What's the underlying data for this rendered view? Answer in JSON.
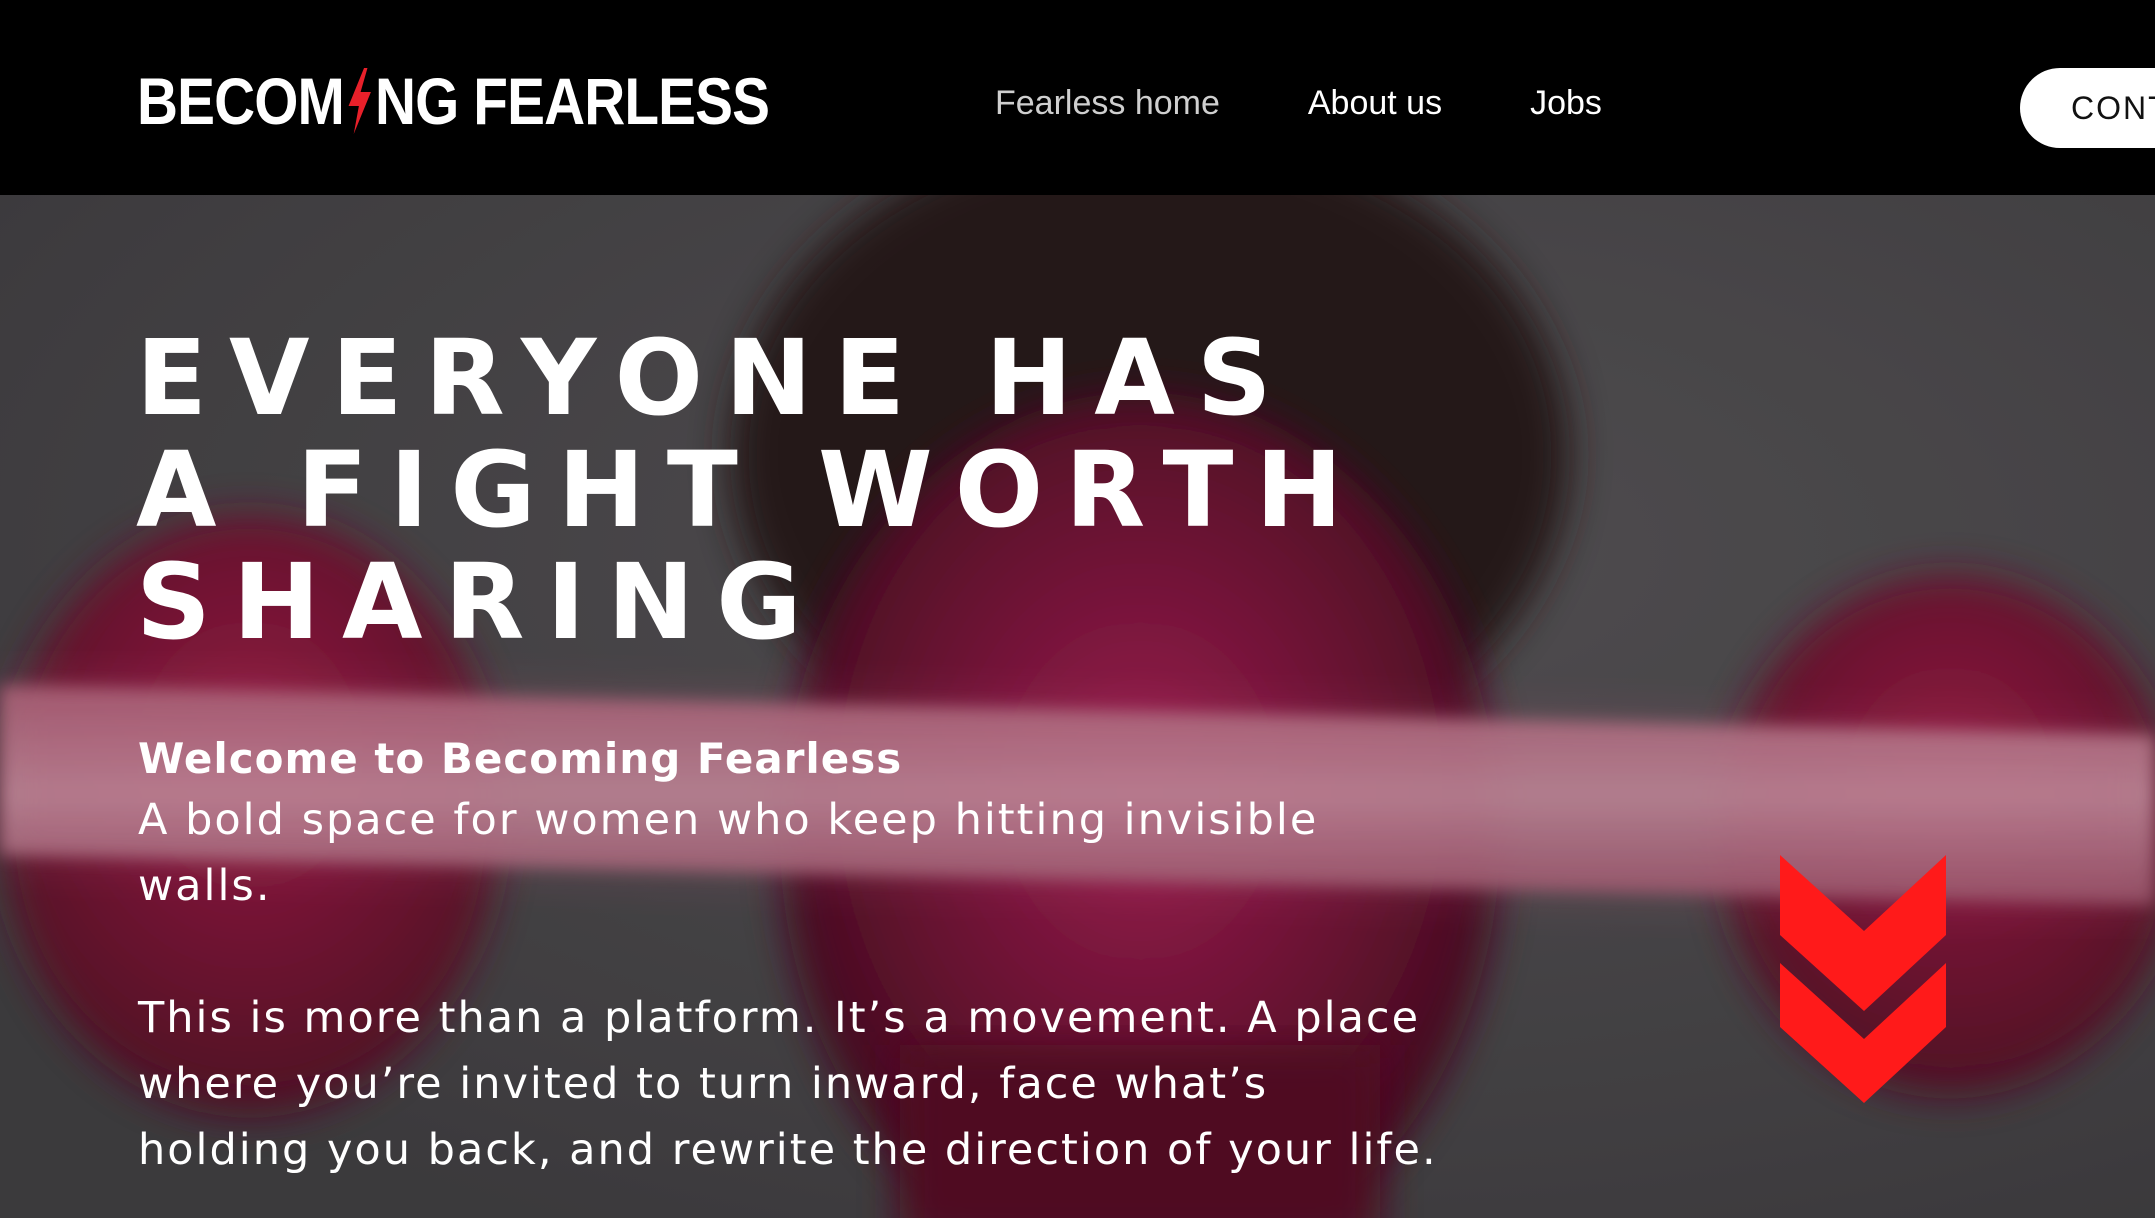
{
  "header": {
    "logo": {
      "part1": "BECOM",
      "part2": "NG FEARLESS",
      "icon": "lightning-bolt-icon",
      "bolt_color": "#e8202a"
    },
    "nav": [
      {
        "label": "Fearless home",
        "active": true
      },
      {
        "label": "About us",
        "active": false
      },
      {
        "label": "Jobs",
        "active": false
      }
    ],
    "cta_label": "CONTACT"
  },
  "hero": {
    "title_lines": [
      "EVERYONE HAS",
      "A FIGHT WORTH",
      "SHARING"
    ],
    "subhead": "Welcome to Becoming Fearless",
    "tagline": "A bold space for women who keep hitting invisible walls.",
    "body": "This is more than a platform. It’s a movement. A place where you’re invited to turn inward, face what’s holding you back, and rewrite the direction of your life.",
    "scroll_icon": "double-chevron-down-icon",
    "accent_color": "#ff1a1a",
    "overlay_tint": "#c4184e"
  }
}
